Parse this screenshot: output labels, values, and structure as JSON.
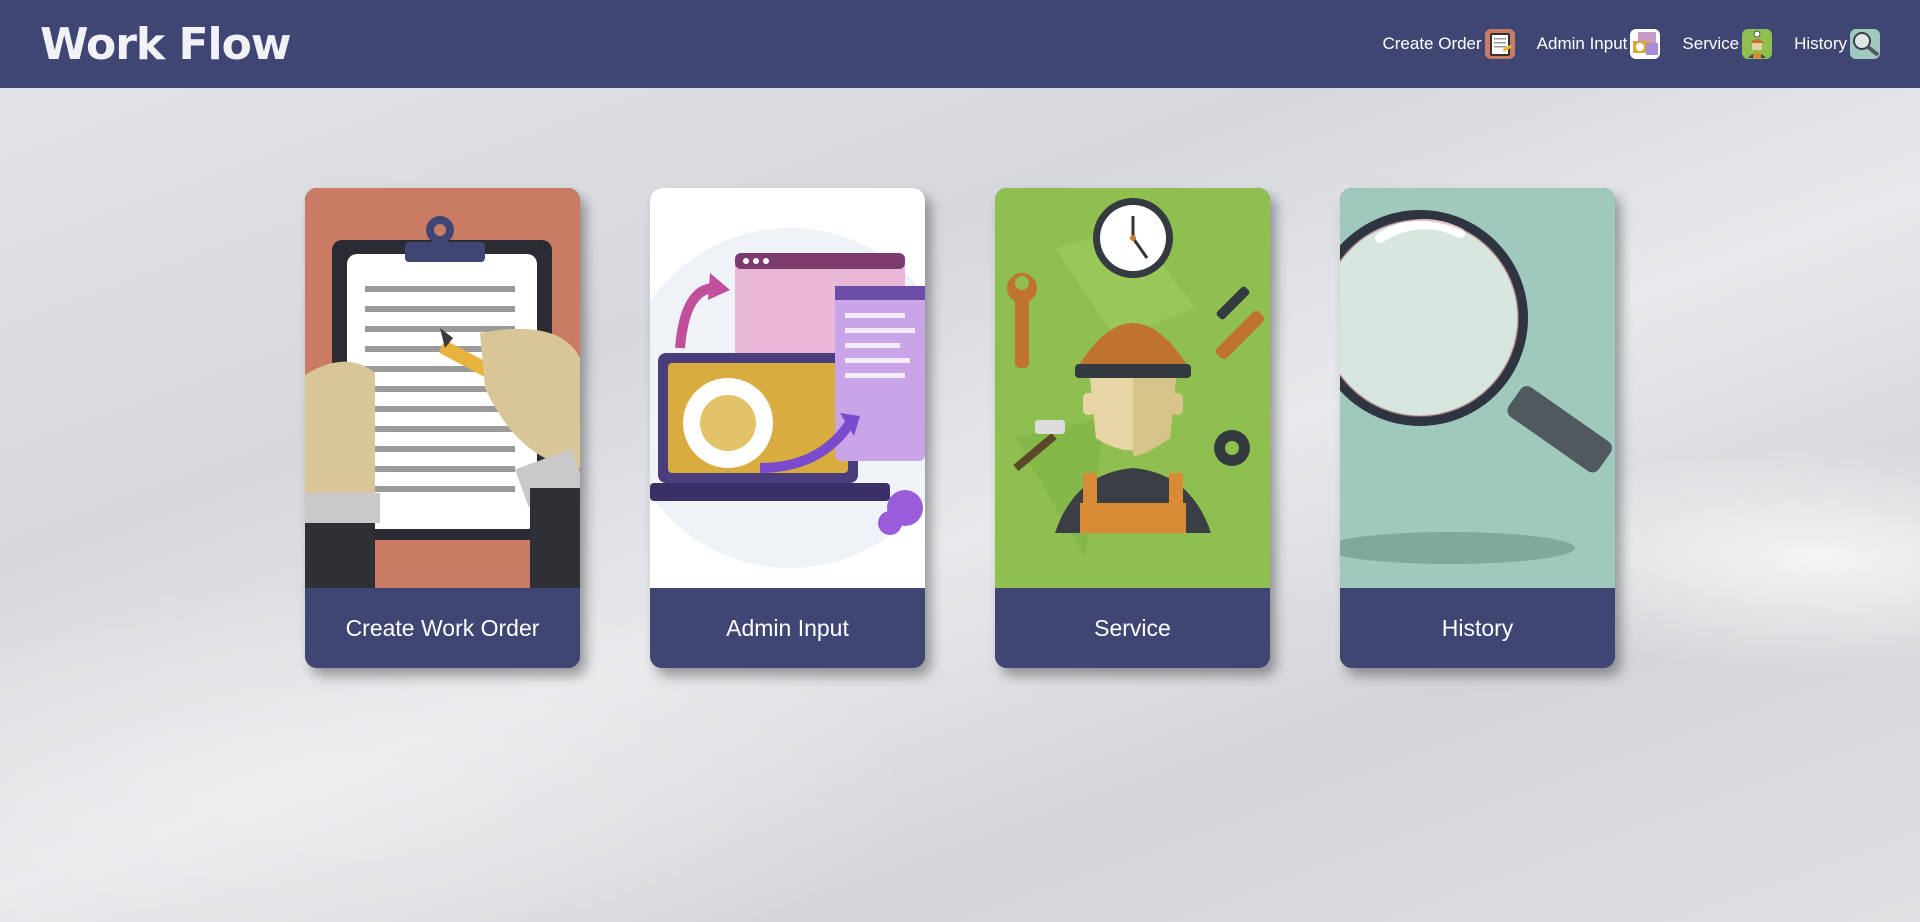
{
  "app": {
    "title": "Work Flow"
  },
  "nav": {
    "items": [
      {
        "label": "Create Order",
        "icon": "clipboard-icon"
      },
      {
        "label": "Admin Input",
        "icon": "admin-screens-icon"
      },
      {
        "label": "Service",
        "icon": "technician-icon"
      },
      {
        "label": "History",
        "icon": "magnifier-icon"
      }
    ]
  },
  "cards": [
    {
      "label": "Create Work Order",
      "icon": "clipboard-illustration",
      "bg": "#c97b63"
    },
    {
      "label": "Admin Input",
      "icon": "admin-dashboard-illustration",
      "bg": "#ffffff"
    },
    {
      "label": "Service",
      "icon": "technician-illustration",
      "bg": "#8fc04f"
    },
    {
      "label": "History",
      "icon": "magnifier-illustration",
      "bg": "#9fc9bd"
    }
  ],
  "colors": {
    "header": "#3f4673",
    "accent": "#3f4673"
  }
}
